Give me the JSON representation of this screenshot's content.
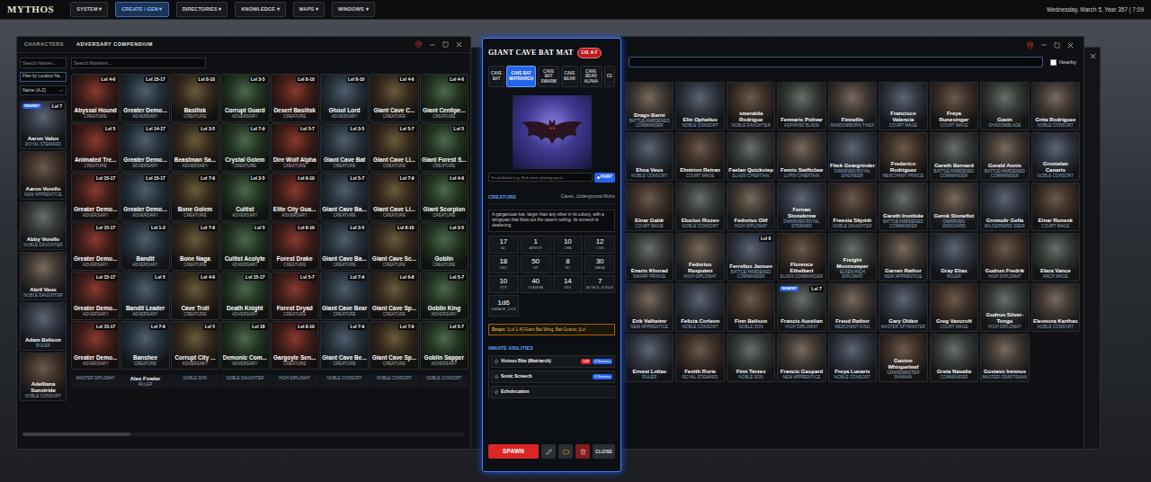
{
  "menubar": {
    "logo": "MYTHOS",
    "menus": [
      {
        "label": "SYSTEM ▾",
        "selected": false
      },
      {
        "label": "CREATE / GEN ▾",
        "selected": true
      },
      {
        "label": "DIRECTORIES ▾",
        "selected": false
      },
      {
        "label": "KNOWLEDGE ▾",
        "selected": false
      },
      {
        "label": "MAPS ▾",
        "selected": false
      },
      {
        "label": "WINDOWS ▾",
        "selected": false
      }
    ],
    "clock": "Wednesday, March 5, Year 357 | 7:09"
  },
  "characters_window": {
    "tabs": [
      {
        "label": "CHARACTERS",
        "selected": false
      },
      {
        "label": "ADVERSARY COMPENDIUM",
        "selected": true
      }
    ],
    "search_placeholder": "Search Names...",
    "location_filter": "Filter by Location Na...",
    "sort": "Name (A-Z)",
    "characters": [
      {
        "name": "Aaron Valus",
        "role": "ROYAL STEWARD",
        "level": "Lvl 7",
        "badge": "NEARBY"
      },
      {
        "name": "Aaron Vorello",
        "role": "NEW APPRENTICE"
      },
      {
        "name": "Abby Vorello",
        "role": "NOBLE DAUGHTER"
      },
      {
        "name": "Abril Veus",
        "role": "NOBLE DAUGHTER"
      },
      {
        "name": "Adam Belison",
        "role": "RULER"
      },
      {
        "name": "Adelliana Sunstride",
        "role": "NOBLE CONSORT"
      }
    ],
    "monster_search_placeholder": "Search Monsters...",
    "monsters": [
      {
        "name": "Abyssal Hound",
        "level": "Lvl 4-6",
        "type": "CREATURE"
      },
      {
        "name": "Greater Demo...",
        "level": "Lvl 15-17",
        "type": "ADVERSARY"
      },
      {
        "name": "Basilisk",
        "level": "Lvl 8-10",
        "type": "CREATURE"
      },
      {
        "name": "Corrupt Guard",
        "level": "Lvl 3-5",
        "type": "ADVERSARY"
      },
      {
        "name": "Desert Basilisk",
        "level": "Lvl 8-10",
        "type": "CREATURE"
      },
      {
        "name": "Ghoul Lord",
        "level": "Lvl 8-10",
        "type": "ADVERSARY"
      },
      {
        "name": "Giant Cave C...",
        "level": "Lvl 4-6",
        "type": "CREATURE"
      },
      {
        "name": "Giant Centipe...",
        "level": "Lvl 4-6",
        "type": "CREATURE"
      },
      {
        "name": "Animated Tre...",
        "level": "Lvl 5",
        "type": "CREATURE"
      },
      {
        "name": "Greater Demo...",
        "level": "Lvl 14-17",
        "type": "ADVERSARY"
      },
      {
        "name": "Beastman Sa...",
        "level": "Lvl 3-5",
        "type": "ADVERSARY"
      },
      {
        "name": "Crystal Golem",
        "level": "Lvl 7-9",
        "type": "CREATURE"
      },
      {
        "name": "Dire Wolf Alpha",
        "level": "Lvl 5-7",
        "type": "CREATURE"
      },
      {
        "name": "Giant Cave Bat",
        "level": "Lvl 3-5",
        "type": "CREATURE"
      },
      {
        "name": "Giant Cave Li...",
        "level": "Lvl 5-7",
        "type": "CREATURE"
      },
      {
        "name": "Giant Forest S...",
        "level": "Lvl 5",
        "type": "CREATURE"
      },
      {
        "name": "Greater Demo...",
        "level": "Lvl 15-17",
        "type": "ADVERSARY"
      },
      {
        "name": "Greater Demo...",
        "level": "Lvl 15-17",
        "type": "ADVERSARY"
      },
      {
        "name": "Bone Golem",
        "level": "Lvl 7-9",
        "type": "CREATURE"
      },
      {
        "name": "Cultist",
        "level": "Lvl 3-5",
        "type": "ADVERSARY"
      },
      {
        "name": "Elite City Gua...",
        "level": "Lvl 9-10",
        "type": "ADVERSARY"
      },
      {
        "name": "Giant Cave Ba...",
        "level": "Lvl 5-7",
        "type": "CREATURE"
      },
      {
        "name": "Giant Cave Li...",
        "level": "Lvl 7-9",
        "type": "CREATURE"
      },
      {
        "name": "Giant Scorpion",
        "level": "Lvl 4-6",
        "type": "CREATURE"
      },
      {
        "name": "Greater Demo...",
        "level": "Lvl 15-17",
        "type": "ADVERSARY"
      },
      {
        "name": "Bandit",
        "level": "Lvl 1-3",
        "type": "ADVERSARY"
      },
      {
        "name": "Bone Naga",
        "level": "Lvl 7-9",
        "type": "CREATURE"
      },
      {
        "name": "Cultist Acolyte",
        "level": "Lvl 5",
        "type": "ADVERSARY"
      },
      {
        "name": "Forest Drake",
        "level": "Lvl 8-10",
        "type": "CREATURE"
      },
      {
        "name": "Giant Cave Ba...",
        "level": "Lvl 3-5",
        "type": "CREATURE"
      },
      {
        "name": "Giant Cave Sc...",
        "level": "Lvl 8-10",
        "type": "CREATURE"
      },
      {
        "name": "Goblin",
        "level": "Lvl 3-5",
        "type": "CREATURE"
      },
      {
        "name": "Greater Demo...",
        "level": "Lvl 15-17",
        "type": "ADVERSARY"
      },
      {
        "name": "Bandit Leader",
        "level": "Lvl 5",
        "type": "ADVERSARY"
      },
      {
        "name": "Cave Troll",
        "level": "Lvl 4-6",
        "type": "CREATURE"
      },
      {
        "name": "Death Knight",
        "level": "Lvl 15-17",
        "type": "ADVERSARY"
      },
      {
        "name": "Forest Dryad",
        "level": "Lvl 5-7",
        "type": "CREATURE"
      },
      {
        "name": "Giant Cave Bear",
        "level": "Lvl 7-9",
        "type": "CREATURE"
      },
      {
        "name": "Giant Cave Sp...",
        "level": "Lvl 6-8",
        "type": "CREATURE"
      },
      {
        "name": "Goblin King",
        "level": "Lvl 5-7",
        "type": "ADVERSARY"
      },
      {
        "name": "Greater Demo...",
        "level": "Lvl 15-17",
        "type": "ADVERSARY"
      },
      {
        "name": "Banshee",
        "level": "Lvl 7-9",
        "type": "CREATURE"
      },
      {
        "name": "Corrupt City ...",
        "level": "Lvl 5",
        "type": "ADVERSARY"
      },
      {
        "name": "Demonic Com...",
        "level": "Lvl 18",
        "type": "ADVERSARY"
      },
      {
        "name": "Gargoyle Sen...",
        "level": "Lvl 8-10",
        "type": "CREATURE"
      },
      {
        "name": "Giant Cave Be...",
        "level": "Lvl 7-9",
        "type": "CREATURE"
      },
      {
        "name": "Giant Cave Sp...",
        "level": "Lvl 7-9",
        "type": "CREATURE"
      },
      {
        "name": "Goblin Sapper",
        "level": "Lvl 5-7",
        "type": "ADVERSARY"
      }
    ],
    "bottom_row": [
      {
        "lines": [
          "MASTER DIPLOMAT"
        ]
      },
      {
        "lines": [
          "Alex Fowler",
          "RULER"
        ]
      },
      {
        "lines": [
          "NOBLE SON"
        ]
      },
      {
        "lines": [
          "NOBLE DAUGHTER"
        ]
      },
      {
        "lines": [
          "HIGH DIPLOMAT"
        ]
      },
      {
        "lines": [
          "NOBLE CONSORT"
        ]
      },
      {
        "lines": [
          "NOBLE CONSORT"
        ]
      },
      {
        "lines": [
          "NOBLE CONSORT"
        ]
      }
    ]
  },
  "monster_window": {
    "title": "GIANT CAVE BAT MAT",
    "level": "LVL 6-7",
    "tabs": [
      {
        "label": "CAVE BAT",
        "selected": false
      },
      {
        "label": "CAVE BAT MATRIARCH",
        "selected": true
      },
      {
        "label": "CAVE BAT SWARM",
        "selected": false
      },
      {
        "label": "CAVE BEAR",
        "selected": false
      },
      {
        "label": "CAVE BEAR ALPHA",
        "selected": false
      },
      {
        "label": "CE",
        "selected": false
      }
    ],
    "visual_placeholder": "Visual details (e.g. Red armor, glowing eyes)...",
    "paint_button": "PAINT",
    "type": "CREATURE",
    "habitat": "Caves, Underground Ruins",
    "description": "A gargantuan bat, larger than any other in its colony, with a wingspan that blots out the cavern ceiling. Its screech is deafening",
    "stats": [
      {
        "value": "17",
        "label": "AC"
      },
      {
        "value": "1",
        "label": "ARMOR"
      },
      {
        "value": "10",
        "label": "CHA"
      },
      {
        "value": "12",
        "label": "CON"
      },
      {
        "value": "18",
        "label": "DEX"
      },
      {
        "value": "50",
        "label": "HP"
      },
      {
        "value": "8",
        "label": "INT"
      },
      {
        "value": "30",
        "label": "MANA"
      },
      {
        "value": "10",
        "label": "STR"
      },
      {
        "value": "40",
        "label": "STAMINA"
      },
      {
        "value": "14",
        "label": "WIS"
      },
      {
        "value": "7",
        "label": "ATTACK_BONUS"
      }
    ],
    "damage": {
      "value": "1d6",
      "label": "DAMAGE_DICE"
    },
    "drops_label": "Drops:",
    "drops": "[Lvl 1-4] Giant Bat Wing, Bat Guano; [Lvl",
    "abilities_title": "INNATE ABILITIES",
    "abilities": [
      {
        "name": "Vicious Bite (Matriarch)",
        "tags": [
          {
            "label": "1d8",
            "color": "#dc2626"
          },
          {
            "label": "4 Stamina",
            "color": "#2563eb"
          }
        ]
      },
      {
        "name": "Sonic Screech",
        "tags": [
          {
            "label": "3 Stamina",
            "color": "#2563eb"
          }
        ]
      },
      {
        "name": "Echolocation",
        "tags": []
      }
    ],
    "spawn_button": "SPAWN",
    "close_button": "CLOSE"
  },
  "roster_window": {
    "nearby": {
      "label": "Nearby",
      "checked": false
    },
    "characters": [
      {
        "name": "Drago Berni",
        "role": "BATTLE-HARDENED COMMANDER"
      },
      {
        "name": "Elin Ophelius",
        "role": "NOBLE CONSORT"
      },
      {
        "name": "smeralda Rodrigue",
        "role": "NOBLE DAUGHTER"
      },
      {
        "name": "Fennaris Polivar",
        "role": "ASPIRING BLADE"
      },
      {
        "name": "Finnellis",
        "role": "SHADOWBORN THIEF"
      },
      {
        "name": "Francisco Valencia",
        "role": "COURT MAGE"
      },
      {
        "name": "Freya Runesinger",
        "role": "COURT MAGE"
      },
      {
        "name": "Gavin",
        "role": "SHADOWBLADE"
      },
      {
        "name": "Grita Rodriguez",
        "role": "NOBLE CONSORT"
      },
      {
        "name": "Ehsa Veus",
        "role": "NOBLE CONSORT"
      },
      {
        "name": "Elmirion Retran",
        "role": "COURT MAGE"
      },
      {
        "name": "Faelan Quickstep",
        "role": "ELVEN CHIEFTAIN"
      },
      {
        "name": "Fenris Swiftclaw",
        "role": "LUPIN CHIEFTAIN"
      },
      {
        "name": "Fitek Geargrinder",
        "role": "DWARVEN ROYAL ENGINEER"
      },
      {
        "name": "Frederico Rodriguez",
        "role": "MERCHANT PRINCE"
      },
      {
        "name": "Gareth Bernard",
        "role": "BATTLE-HARDENED COMMANDER"
      },
      {
        "name": "Gerald Annis",
        "role": "BATTLE-HARDENED COMMANDER"
      },
      {
        "name": "Gromelan Canaris",
        "role": "NOBLE CONSORT"
      },
      {
        "name": "Einar Galdr",
        "role": "COURT MAGE"
      },
      {
        "name": "Elucius Rizzeo",
        "role": "NOBLE CONSORT"
      },
      {
        "name": "Fedorius Olif",
        "role": "HIGH DIPLOMAT"
      },
      {
        "name": "Fernan Stonebrow",
        "role": "DWARVEN ROYAL STEWARD"
      },
      {
        "name": "Freesia Skjoldr",
        "role": "NOBLE DAUGHTER"
      },
      {
        "name": "Gareth Ironhide",
        "role": "BATTLE-HARDENED COMMANDER"
      },
      {
        "name": "Gerok Stonefist",
        "role": "DWARVEN VANGUARD"
      },
      {
        "name": "Gromulir Gella",
        "role": "WILDERNESS SEER"
      },
      {
        "name": "Einar Runesk",
        "role": "COURT MAGE"
      },
      {
        "name": "Enaris Khorad",
        "role": "DWARF PRINCE"
      },
      {
        "name": "Fedorius Rasputen",
        "role": "HIGH DIPLOMAT"
      },
      {
        "name": "Ferrelius Jansen",
        "role": "BATTLE-HARDENED COMMANDER",
        "level": "Lvl 8"
      },
      {
        "name": "Florence Ethelbert",
        "role": "ELVEN COMMANDER"
      },
      {
        "name": "Freight Moonseeper",
        "role": "ELVEN HIGH DIPLOMAT"
      },
      {
        "name": "Garren Rathor",
        "role": "NEW APPRENTICE"
      },
      {
        "name": "Gray Elias",
        "role": "RULER"
      },
      {
        "name": "Gudrun Fredrik",
        "role": "HIGH DIPLOMAT"
      },
      {
        "name": "Elara Vance",
        "role": "ARCH MAGE"
      },
      {
        "name": "Erik Valheimr",
        "role": "NEW APPRENTICE"
      },
      {
        "name": "Felicia Corleon",
        "role": "NOBLE CONSORT"
      },
      {
        "name": "Finn Belison",
        "role": "NOBLE SON"
      },
      {
        "name": "Francis Aurelian",
        "role": "HIGH DIPLOMAT",
        "level": "Lvl 7",
        "badge": "NEARBY"
      },
      {
        "name": "Freud Rathor",
        "role": "MERCHANT KING"
      },
      {
        "name": "Gary Olden",
        "role": "MASTER SPYMASTER"
      },
      {
        "name": "Greg Vancroft",
        "role": "COURT MAGE"
      },
      {
        "name": "Gudrun Silver-Tongu",
        "role": "HIGH DIPLOMAT"
      },
      {
        "name": "Eleonora Karthas",
        "role": "NOBLE CONSORT"
      },
      {
        "name": "Ernest Lolias",
        "role": "RULER"
      },
      {
        "name": "Fenith Rorie",
        "role": "ROYAL STEWARD"
      },
      {
        "name": "Finn Terzes",
        "role": "NOBLE SON"
      },
      {
        "name": "Francis Gaspard",
        "role": "NEW APPRENTICE"
      },
      {
        "name": "Freya Lunaris",
        "role": "NOBLE CONSORT"
      },
      {
        "name": "Gaston Whisperleaf",
        "role": "GRANDMASTER SHAMAN"
      },
      {
        "name": "Greta Navalia",
        "role": "COMMANDER"
      },
      {
        "name": "Gustavo Irennus",
        "role": "MASTER CRAFTSMAN"
      }
    ]
  }
}
